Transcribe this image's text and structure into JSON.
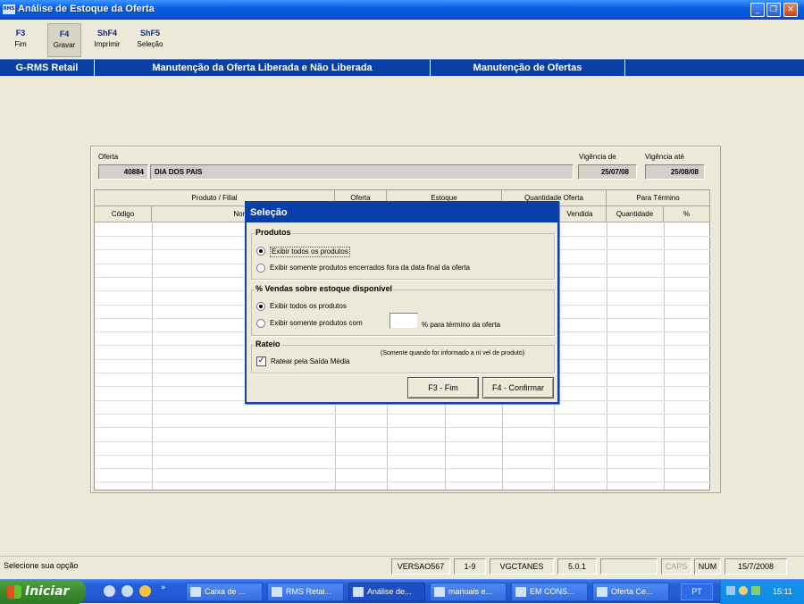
{
  "window": {
    "app_icon": "RMS",
    "title": "Análise de Estoque da Oferta"
  },
  "toolbar": [
    {
      "key": "F3",
      "label": "Fim"
    },
    {
      "key": "F4",
      "label": "Gravar"
    },
    {
      "key": "ShF4",
      "label": "Imprimir"
    },
    {
      "key": "ShF5",
      "label": "Seleção"
    }
  ],
  "tabs": [
    "G-RMS Retail",
    "Manutenção da Oferta Liberada e Não Liberada",
    "Manutenção de Ofertas"
  ],
  "oferta": {
    "label": "Oferta",
    "codigo": "40884",
    "descricao": "DIA DOS PAIS",
    "vigencia_de_label": "Vigência de",
    "vigencia_de": "25/07/08",
    "vigencia_ate_label": "Vigência até",
    "vigencia_ate": "25/08/08"
  },
  "grid": {
    "group_headers": [
      "Produto / Filial",
      "Oferta",
      "Estoque",
      "Quantidade Oferta",
      "Para Término"
    ],
    "col_headers": [
      "Código",
      "Nome",
      "",
      "",
      "",
      "",
      "",
      "",
      "Vendida",
      "Quantidade",
      "%"
    ]
  },
  "dialog": {
    "title": "Seleção",
    "produtos": {
      "title": "Produtos",
      "opt1": "Exibir todos os produtos",
      "opt2": "Exibir somente produtos encerrados fora da data final da oferta"
    },
    "vendas": {
      "title": "% Vendas sobre estoque disponível",
      "opt1": "Exibir todos os produtos",
      "opt2": "Exibir somente produtos com",
      "suffix": "% para término da oferta",
      "value": ""
    },
    "rateio": {
      "title": "Rateio",
      "note": "(Somente quando for informado a ní vel de produto)",
      "check": "Ratear pela Saída Média",
      "checked": true
    },
    "btn_fim": "F3 - Fim",
    "btn_confirmar": "F4 - Confirmar"
  },
  "status": {
    "message": "Selecione sua opção",
    "versao": "VERSAO567",
    "page": "1-9",
    "user": "VGCTANES",
    "version": "5.0.1",
    "caps": "CAPS",
    "num": "NUM",
    "date": "15/7/2008"
  },
  "taskbar": {
    "start": "Iniciar",
    "items": [
      "Caixa de ...",
      "RMS Retai...",
      "Análise de...",
      "manuais e...",
      "EM CONS...",
      "Oferta Ce..."
    ],
    "lang": "PT",
    "time": "15:11"
  }
}
